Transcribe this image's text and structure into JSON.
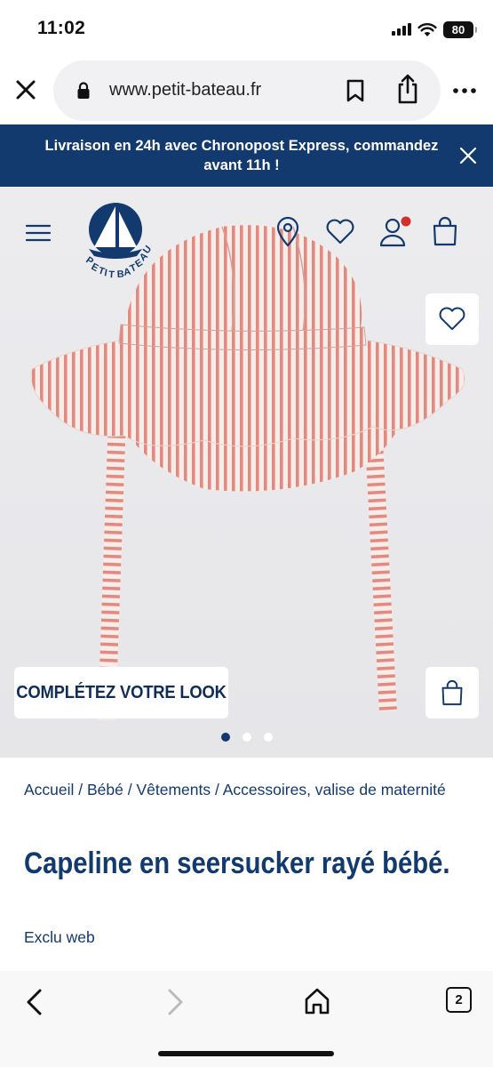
{
  "status_bar": {
    "time": "11:02",
    "battery": "80"
  },
  "browser": {
    "url": "www.petit-bateau.fr"
  },
  "promo": {
    "text": "Livraison en 24h avec Chronopost Express, commandez avant 11h !"
  },
  "header": {
    "logo_text": "PETIT BATEAU",
    "notification_color": "#d0312d"
  },
  "hero": {
    "look_button": "COMPLÉTEZ VOTRE LOOK",
    "carousel_count": 3,
    "carousel_active": 1
  },
  "product": {
    "breadcrumb": "Accueil / Bébé / Vêtements / Accessoires, valise de maternité",
    "title": "Capeline en seersucker rayé bébé.",
    "tag": "Exclu web"
  },
  "toolbar": {
    "tabs_count": "2"
  },
  "colors": {
    "brand_navy": "#123a6e",
    "stripe_red": "#e07a74"
  }
}
